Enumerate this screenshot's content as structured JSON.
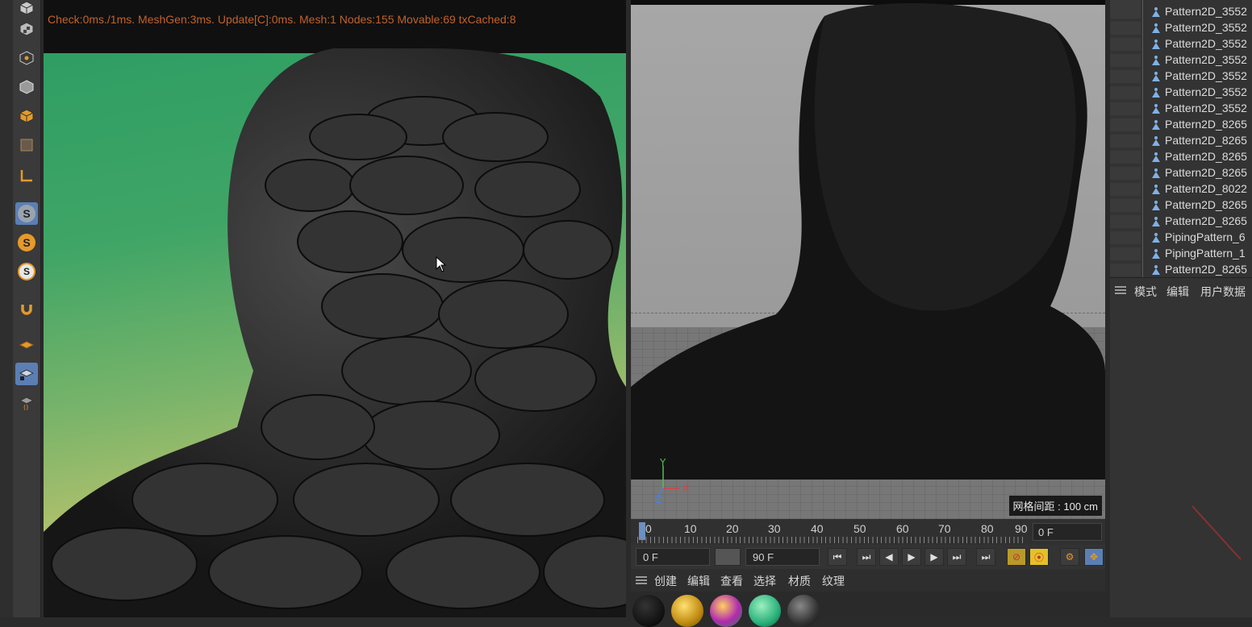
{
  "viewport_left": {
    "stats": "Check:0ms./1ms. MeshGen:3ms. Update[C]:0ms. Mesh:1 Nodes:155 Movable:69 txCached:8"
  },
  "viewport_right": {
    "grid_spacing": "网格间距 : 100 cm",
    "axis": {
      "y": "Y",
      "x": "X",
      "z": "Z"
    }
  },
  "timeline": {
    "ticks": [
      "0",
      "10",
      "20",
      "30",
      "40",
      "50",
      "60",
      "70",
      "80",
      "90"
    ],
    "current_frame": "0 F"
  },
  "transport": {
    "start_frame": "0 F",
    "end_frame": "90 F"
  },
  "material_menu": [
    "创建",
    "编辑",
    "查看",
    "选择",
    "材质",
    "纹理"
  ],
  "materials": [
    "black",
    "gold",
    "iridescent",
    "teal",
    "dark-grey"
  ],
  "object_list": [
    "Pattern2D_3552",
    "Pattern2D_3552",
    "Pattern2D_3552",
    "Pattern2D_3552",
    "Pattern2D_3552",
    "Pattern2D_3552",
    "Pattern2D_3552",
    "Pattern2D_8265",
    "Pattern2D_8265",
    "Pattern2D_8265",
    "Pattern2D_8265",
    "Pattern2D_8022",
    "Pattern2D_8265",
    "Pattern2D_8265",
    "PipingPattern_6",
    "PipingPattern_1",
    "Pattern2D_8265"
  ],
  "attributes_menu": [
    "模式",
    "编辑",
    "用户数据"
  ],
  "colors": {
    "stats_text": "#c0622b",
    "active_tool": "#5b7fb5",
    "record_button": "#e6c029"
  }
}
